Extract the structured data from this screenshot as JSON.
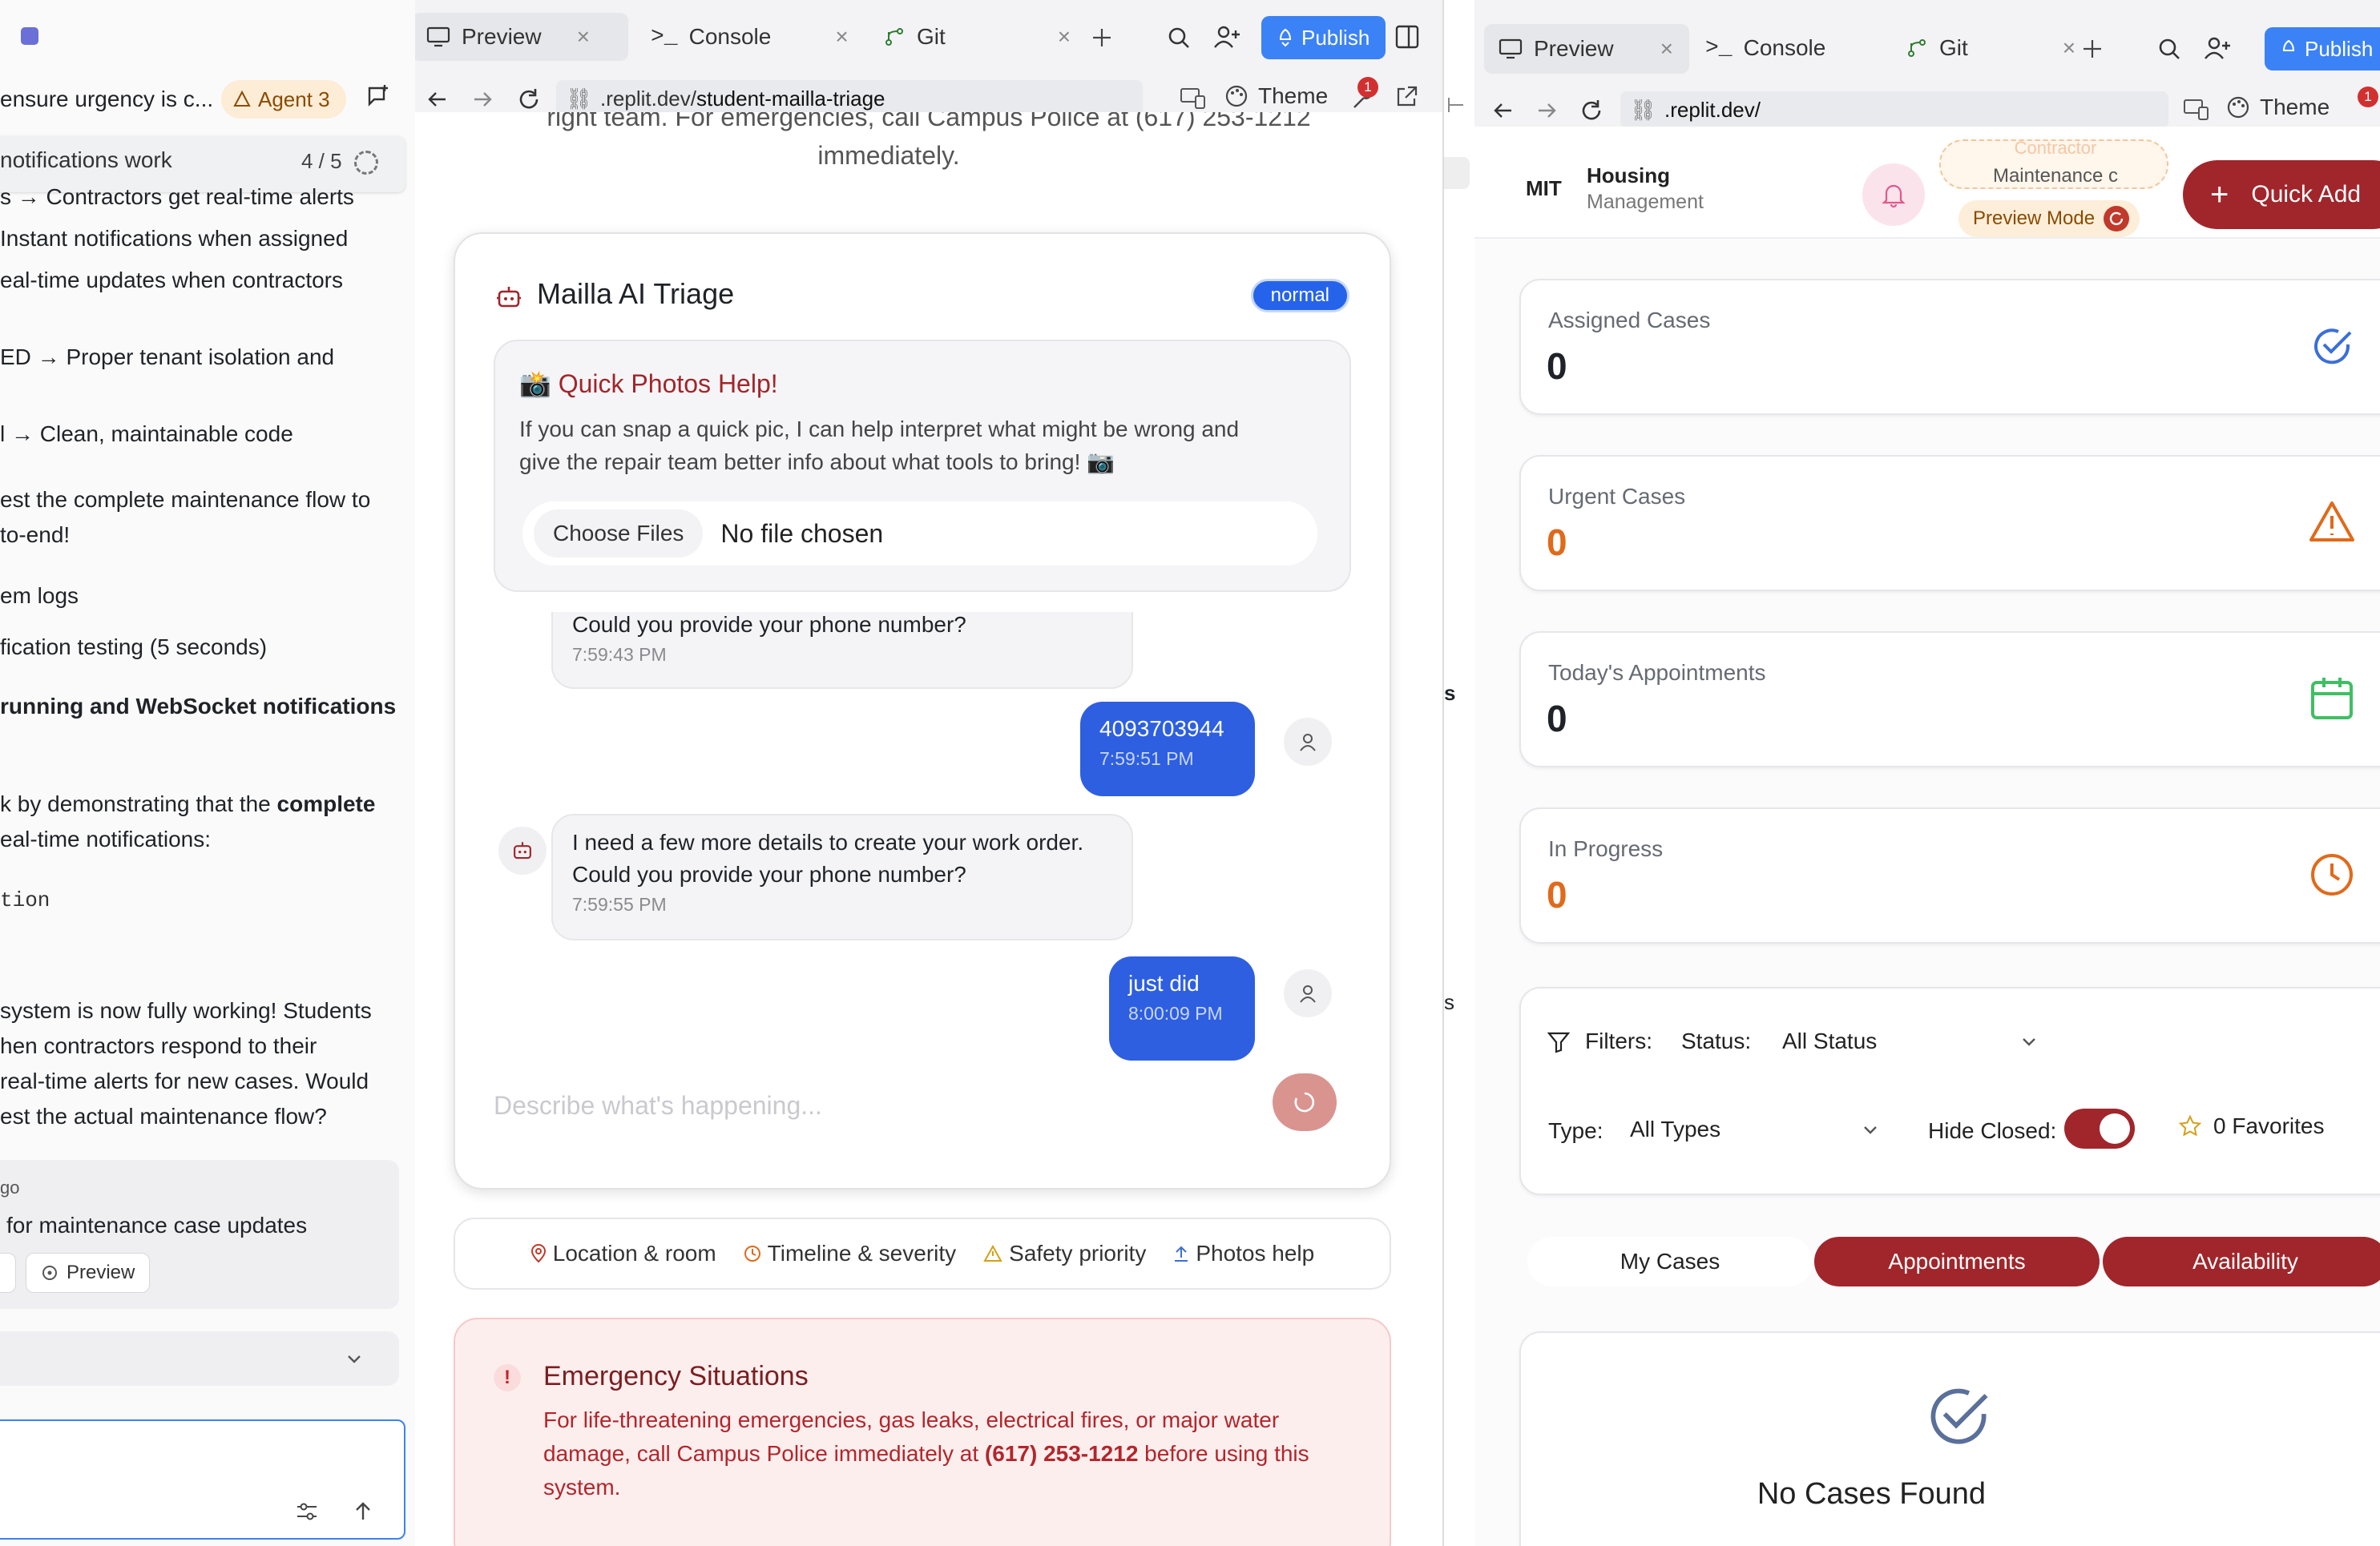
{
  "chat_pane": {
    "header_text": "ensure urgency is c...",
    "agent_badge": "Agent 3",
    "progress_title": "notifications work",
    "progress_count": "4 / 5",
    "lines": [
      "s → Contractors get real-time alerts",
      "Instant notifications when assigned",
      "eal-time updates when contractors",
      "ED → Proper tenant isolation and",
      "l → Clean, maintainable code",
      "est the complete maintenance flow to",
      "to-end!",
      "em logs",
      "fication testing (5 seconds)",
      "running and WebSocket notifications",
      "k by demonstrating that the complete",
      "eal-time notifications:",
      "tion",
      "system is now fully working! Students",
      "hen contractors respond to their",
      "real-time alerts for new cases. Would",
      "est the actual maintenance flow?"
    ],
    "bold_word": "complete",
    "card_time": "go",
    "card_text": "for maintenance case updates",
    "preview_chip": "Preview"
  },
  "mid_pane": {
    "tabs": [
      "Preview",
      "Console",
      "Git"
    ],
    "publish_label": "Publish",
    "url_prefix": ".replit.dev/",
    "url_path": "student-mailla-triage",
    "theme_label": "Theme",
    "notif_count": "1",
    "top_fragment_1": "right team. For emergencies, call Campus Police at (617) 253-1212",
    "top_fragment_2": "immediately.",
    "triage": {
      "title": "Mailla AI Triage",
      "badge": "normal",
      "photos_title": "📸 Quick Photos Help!",
      "photos_text_1": "If you can snap a quick pic, I can help interpret what might be wrong and",
      "photos_text_2": "give the repair team better info about what tools to bring! 📷",
      "choose_files": "Choose Files",
      "no_file": "No file chosen",
      "messages": [
        {
          "from": "bot",
          "lines": [
            "Could you provide your phone number?"
          ],
          "time": "7:59:43 PM"
        },
        {
          "from": "user",
          "lines": [
            "4093703944"
          ],
          "time": "7:59:51 PM"
        },
        {
          "from": "bot",
          "lines": [
            "I need a few more details to create your work order.",
            "Could you provide your phone number?"
          ],
          "time": "7:59:55 PM"
        },
        {
          "from": "user",
          "lines": [
            "just did"
          ],
          "time": "8:00:09 PM"
        }
      ],
      "compose_placeholder": "Describe what's happening..."
    },
    "hints": [
      "Location & room",
      "Timeline & severity",
      "Safety priority",
      "Photos help"
    ],
    "emergency": {
      "title": "Emergency Situations",
      "text_1": "For life-threatening emergencies, gas leaks, electrical fires, or major water",
      "text_2a": "damage, call Campus Police immediately at ",
      "phone": "(617) 253-1212",
      "text_2b": " before using this",
      "text_3": "system."
    }
  },
  "right_pane": {
    "tabs": [
      "Preview",
      "Console",
      "Git"
    ],
    "publish_label": "Publish",
    "url": ".replit.dev/",
    "theme_label": "Theme",
    "notif_count": "1",
    "mid_letters": [
      "s",
      "s"
    ],
    "app": {
      "logo": "MIT",
      "brand_title": "Housing",
      "brand_sub": "Management",
      "role_top": "Contractor",
      "role_label": "Maintenance c",
      "preview_mode": "Preview Mode",
      "quick_add": "Quick Add",
      "stats": [
        {
          "label": "Assigned Cases",
          "value": "0",
          "color": "#1f2328",
          "icon": "check-circle-icon"
        },
        {
          "label": "Urgent Cases",
          "value": "0",
          "color": "#e06a1b",
          "icon": "warning-triangle-icon"
        },
        {
          "label": "Today's Appointments",
          "value": "0",
          "color": "#1f2328",
          "icon": "calendar-icon"
        },
        {
          "label": "In Progress",
          "value": "0",
          "color": "#e06a1b",
          "icon": "clock-icon"
        }
      ],
      "filters_label": "Filters:",
      "status_label": "Status:",
      "status_value": "All Status",
      "type_label": "Type:",
      "type_value": "All Types",
      "hide_closed_label": "Hide Closed:",
      "hide_closed_on": true,
      "favorites": "0 Favorites",
      "segments": [
        "My Cases",
        "Appointments",
        "Availability"
      ],
      "empty_title": "No Cases Found"
    }
  },
  "colors": {
    "accent_blue": "#3b82f6",
    "brand_red": "#a0262b",
    "urgent_orange": "#e06a1b",
    "success_green": "#3fbf63"
  }
}
